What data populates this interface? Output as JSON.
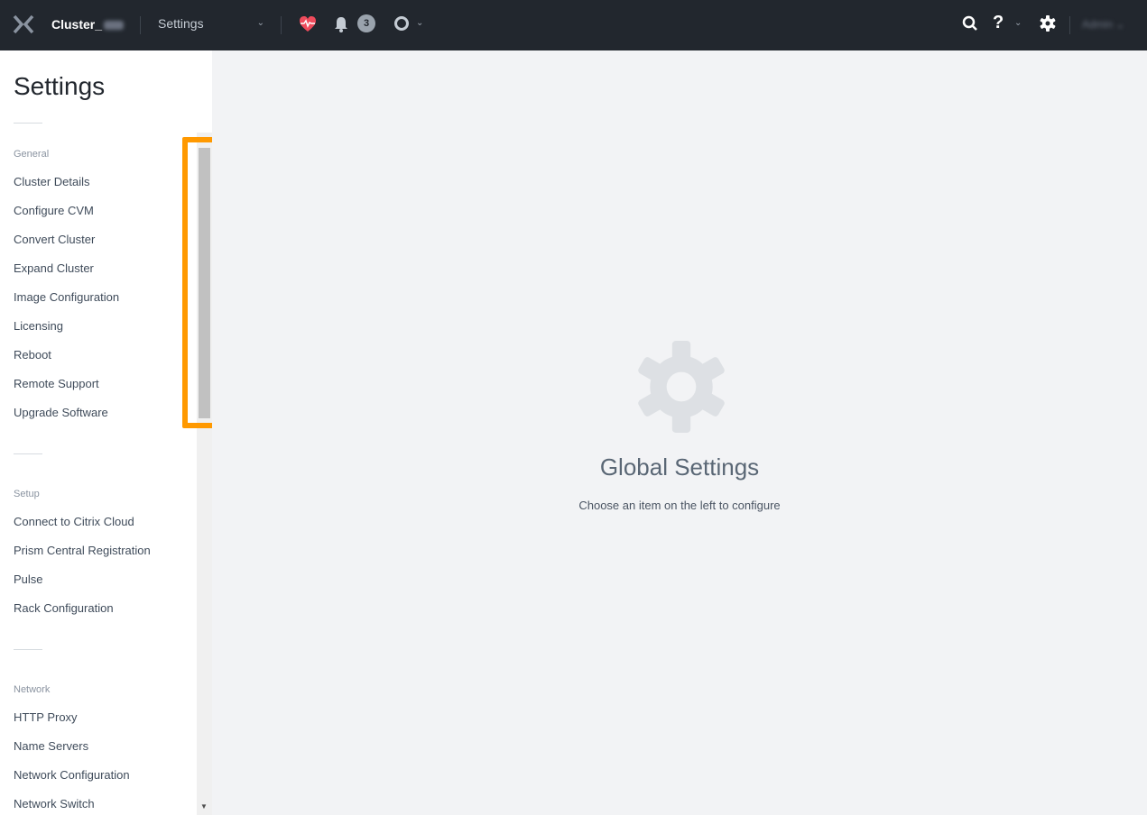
{
  "header": {
    "cluster_name": "Cluster_",
    "nav_menu_label": "Settings",
    "alerts_count": "3",
    "user_name": "Admin"
  },
  "icons": {
    "logo": "nutanix-x-logo-icon",
    "health": "heart-pulse-icon",
    "alerts": "bell-icon",
    "tasks": "circle-icon",
    "search": "search-icon",
    "help": "question-icon",
    "settings": "gear-icon"
  },
  "colors": {
    "topbar": "#22272e",
    "health": "#ef4b5c",
    "highlight": "#ff9900"
  },
  "sidebar": {
    "title": "Settings",
    "sections": [
      {
        "label": "General",
        "items": [
          "Cluster Details",
          "Configure CVM",
          "Convert Cluster",
          "Expand Cluster",
          "Image Configuration",
          "Licensing",
          "Reboot",
          "Remote Support",
          "Upgrade Software"
        ]
      },
      {
        "label": "Setup",
        "items": [
          "Connect to Citrix Cloud",
          "Prism Central Registration",
          "Pulse",
          "Rack Configuration"
        ]
      },
      {
        "label": "Network",
        "items": [
          "HTTP Proxy",
          "Name Servers",
          "Network Configuration",
          "Network Switch"
        ]
      }
    ]
  },
  "main": {
    "title": "Global Settings",
    "subtitle": "Choose an item on the left to configure"
  }
}
